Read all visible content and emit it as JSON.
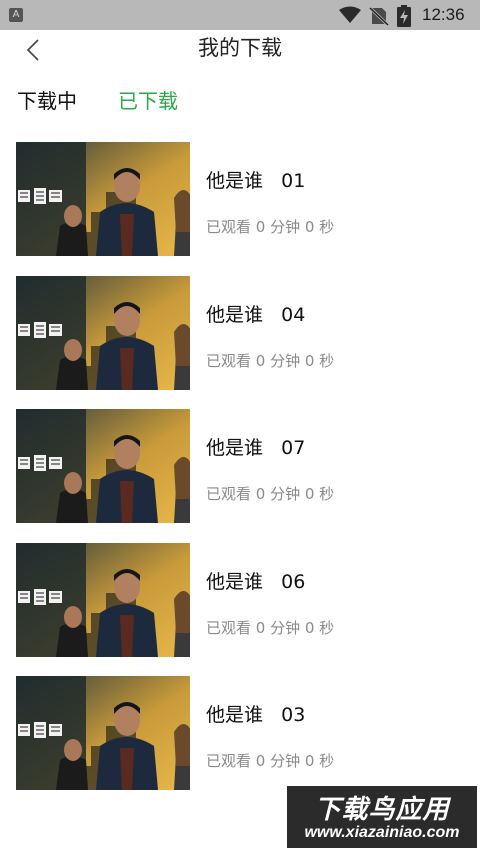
{
  "status_bar": {
    "app_icon_letter": "A",
    "time": "12:36",
    "icons": [
      "wifi-icon",
      "no-sim-icon",
      "battery-charging-icon"
    ]
  },
  "header": {
    "back_icon": "chevron-left-icon",
    "title": "我的下载"
  },
  "tabs": {
    "downloading_label": "下载中",
    "downloaded_label": "已下载",
    "active": "downloaded",
    "active_color": "#2aa84a"
  },
  "items": [
    {
      "title": "他是谁   01",
      "progress": "已观看 0 分钟 0 秒"
    },
    {
      "title": "他是谁   04",
      "progress": "已观看 0 分钟 0 秒"
    },
    {
      "title": "他是谁   07",
      "progress": "已观看 0 分钟 0 秒"
    },
    {
      "title": "他是谁   06",
      "progress": "已观看 0 分钟 0 秒"
    },
    {
      "title": "他是谁   03",
      "progress": "已观看 0 分钟 0 秒"
    }
  ],
  "watermark": {
    "title": "下载鸟应用",
    "url": "www.xiazainiao.com"
  }
}
